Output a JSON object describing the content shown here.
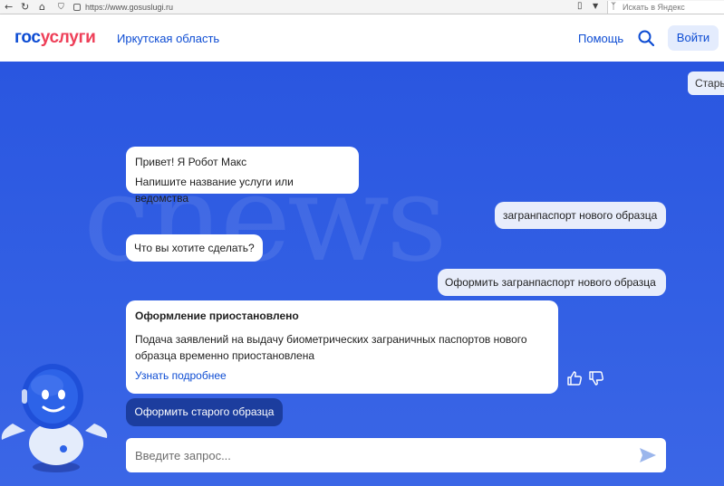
{
  "browser": {
    "url": "https://www.gosuslugi.ru",
    "search_placeholder": "Искать в Яндекс",
    "icons": [
      "back-icon",
      "reload-icon",
      "home-icon",
      "shield-icon",
      "lock-icon",
      "bookmark-icon",
      "dropdown-icon",
      "yandex-search-icon"
    ]
  },
  "header": {
    "logo_part1": "гос",
    "logo_part2": "услуги",
    "region": "Иркутская область",
    "help_label": "Помощь",
    "login_label": "Войти",
    "colors": {
      "brand_blue": "#0d4cd3",
      "brand_red": "#ee3f58"
    }
  },
  "chat": {
    "old_version_label": "Стары",
    "watermark": "cnews",
    "messages": [
      {
        "from": "bot",
        "lines": [
          "Привет! Я Робот Макс",
          "Напишите название услуги или ведомства"
        ]
      },
      {
        "from": "user",
        "text": "загранпаспорт нового образца"
      },
      {
        "from": "bot",
        "text": "Что вы хотите сделать?"
      },
      {
        "from": "user",
        "text": "Оформить загранпаспорт нового образца"
      },
      {
        "from": "bot",
        "title": "Оформление приостановлено",
        "body": "Подача заявлений на выдачу биометрических заграничных паспортов нового образца временно приостановлена",
        "link": "Узнать подробнее"
      }
    ],
    "action_button": "Оформить старого образца",
    "input_placeholder": "Введите запрос...",
    "colors": {
      "background": "#2e5de0",
      "action_button": "#1c3d9e",
      "user_bubble": "#e8edfb"
    }
  }
}
